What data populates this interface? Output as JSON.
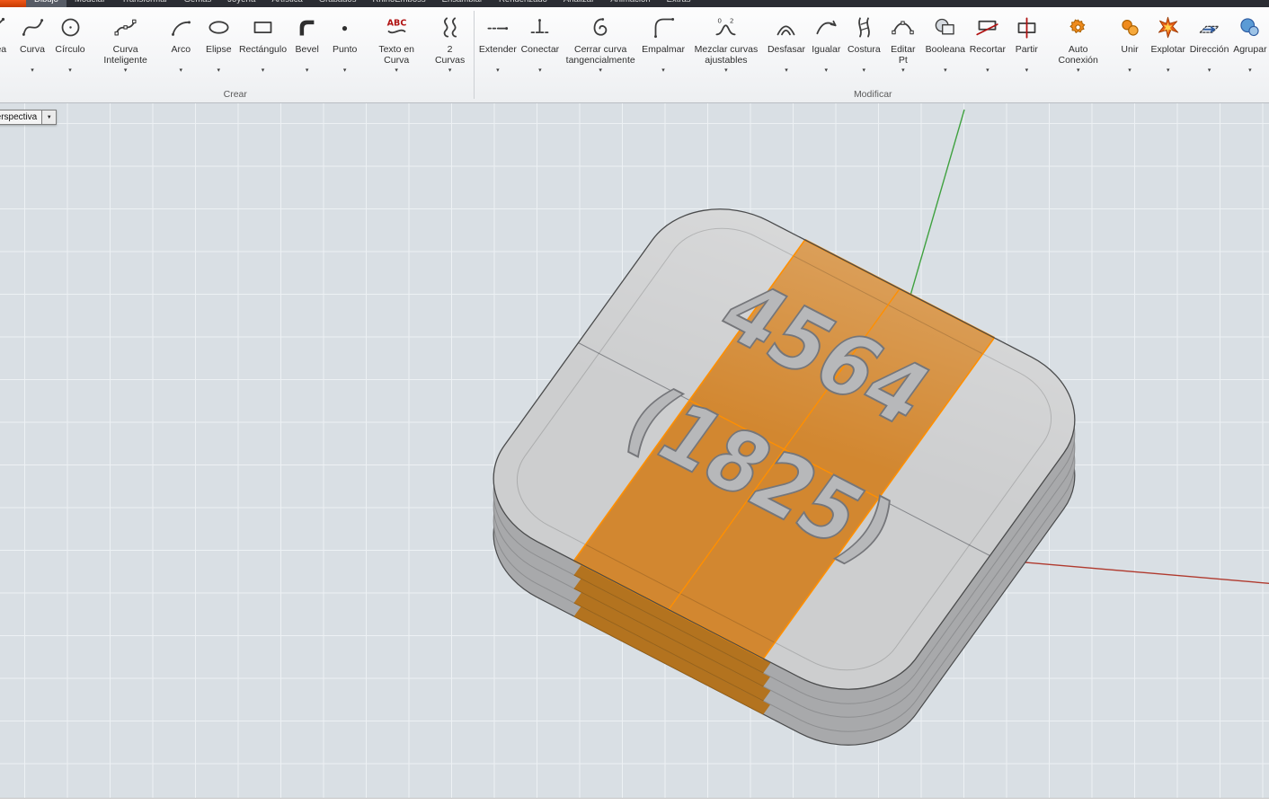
{
  "menu": {
    "tabs": [
      {
        "label": "Dibujo",
        "active": true
      },
      {
        "label": "Modelar"
      },
      {
        "label": "Transformar"
      },
      {
        "label": "Gemas"
      },
      {
        "label": "Joyería"
      },
      {
        "label": "Artística"
      },
      {
        "label": "Grabados"
      },
      {
        "label": "RhinoEmboss"
      },
      {
        "label": "Ensamblar"
      },
      {
        "label": "Renderizado"
      },
      {
        "label": "Analizar"
      },
      {
        "label": "Animación"
      },
      {
        "label": "Extras"
      }
    ]
  },
  "toolbar": {
    "groups": [
      {
        "name": "Crear",
        "tools": [
          {
            "label": "Línea",
            "icon": "line-icon",
            "clipped": true
          },
          {
            "label": "Curva",
            "icon": "curve-icon"
          },
          {
            "label": "Círculo",
            "icon": "circle-icon"
          },
          {
            "label": "Curva Inteligente",
            "icon": "smart-curve-icon"
          },
          {
            "label": "Arco",
            "icon": "arc-icon"
          },
          {
            "label": "Elipse",
            "icon": "ellipse-icon"
          },
          {
            "label": "Rectángulo",
            "icon": "rectangle-icon"
          },
          {
            "label": "Bevel",
            "icon": "bevel-icon"
          },
          {
            "label": "Punto",
            "icon": "point-icon"
          },
          {
            "label": "Texto en Curva",
            "icon": "text-on-curve-icon"
          },
          {
            "label": "2 Curvas",
            "icon": "two-curves-icon"
          }
        ]
      },
      {
        "name": "Modificar",
        "tools": [
          {
            "label": "Extender",
            "icon": "extend-icon"
          },
          {
            "label": "Conectar",
            "icon": "connect-icon"
          },
          {
            "label": "Cerrar curva tangencialmente",
            "icon": "close-curve-icon"
          },
          {
            "label": "Empalmar",
            "icon": "fillet-icon"
          },
          {
            "label": "Mezclar curvas ajustables",
            "icon": "blend-icon"
          },
          {
            "label": "Desfasar",
            "icon": "offset-icon"
          },
          {
            "label": "Igualar",
            "icon": "match-icon"
          },
          {
            "label": "Costura",
            "icon": "seam-icon"
          },
          {
            "label": "Editar Pt",
            "icon": "edit-points-icon"
          },
          {
            "label": "Booleana",
            "icon": "boolean-icon"
          },
          {
            "label": "Recortar",
            "icon": "trim-icon"
          },
          {
            "label": "Partir",
            "icon": "split-icon"
          },
          {
            "label": "Auto Conexión",
            "icon": "auto-connect-icon"
          },
          {
            "label": "Unir",
            "icon": "join-icon"
          },
          {
            "label": "Explotar",
            "icon": "explode-icon"
          },
          {
            "label": "Dirección",
            "icon": "direction-icon"
          },
          {
            "label": "Agrupar",
            "icon": "group-icon"
          }
        ]
      }
    ]
  },
  "viewport": {
    "label": "Perspectiva",
    "object_text": {
      "line1": "4564",
      "line2": "(1825)"
    }
  },
  "colors": {
    "selection_orange": "#ff8f00",
    "body_orange_top": "#d28730",
    "body_orange_side": "#b3731f",
    "metal_gray_top": "#cdcecf",
    "metal_gray_side": "#a8a9ab",
    "edge_dark": "#4a4b4c",
    "axis_green": "#3fa13f",
    "axis_red": "#b03a2e",
    "viewport_bg": "#d9dfe4",
    "grid_line": "#edf1f4"
  }
}
